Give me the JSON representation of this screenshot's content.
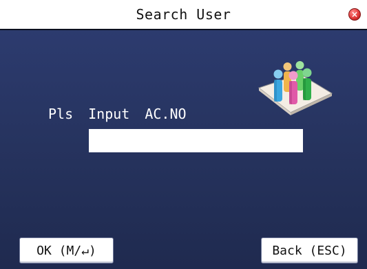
{
  "window": {
    "title": "Search User",
    "close_icon_glyph": "×"
  },
  "prompt": {
    "words": [
      "Pls",
      "Input",
      "AC.NO"
    ]
  },
  "ac_input": {
    "value": ""
  },
  "softkeys": {
    "ok_label": "OK (M/↵)",
    "back_label": "Back (ESC)"
  },
  "icons": {
    "close": "close-icon",
    "illustration": "users-group-icon"
  },
  "colors": {
    "background": "#2a3763",
    "titlebar": "#ffffff",
    "close_button": "#e23b3b"
  }
}
